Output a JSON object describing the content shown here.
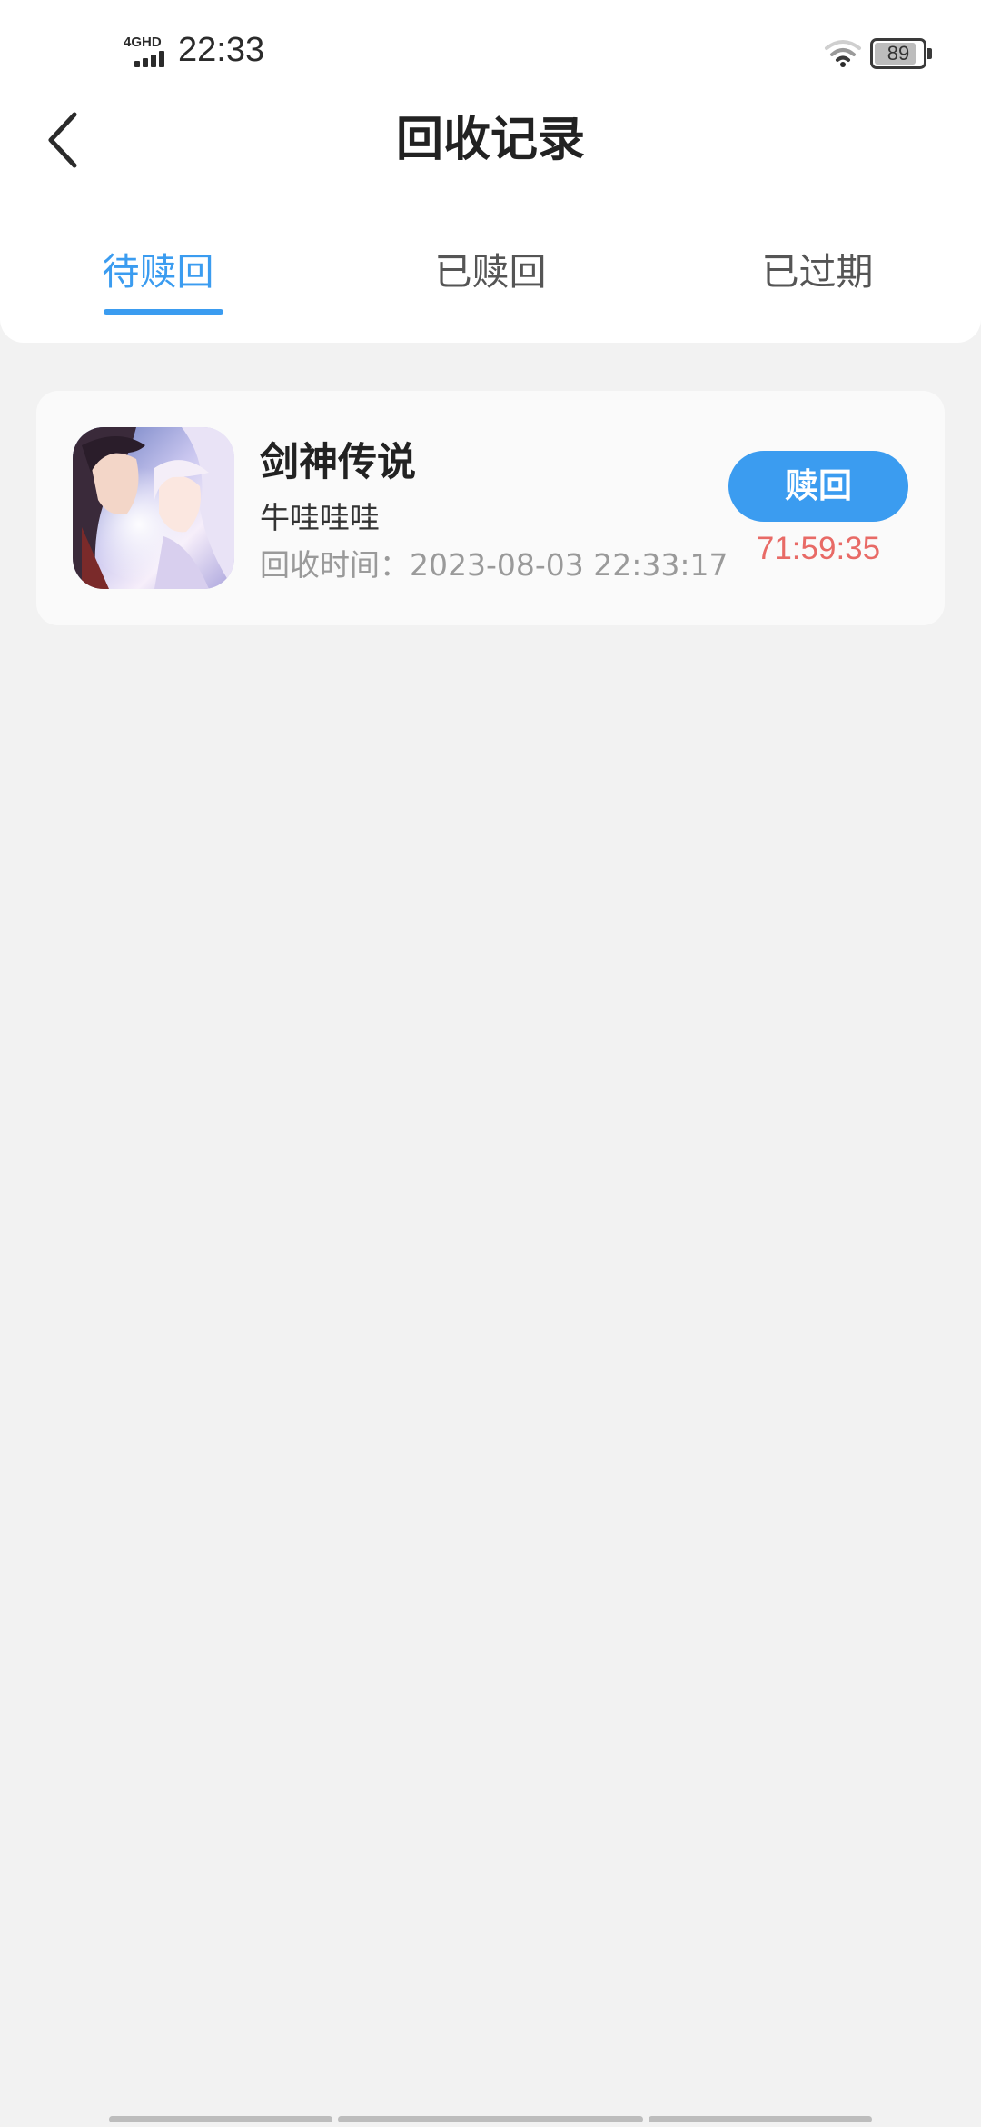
{
  "status_bar": {
    "network": "4GHD",
    "time": "22:33",
    "battery": "89",
    "battery_level": 0.89,
    "wifi_icon": "wifi-icon",
    "signal_icon": "signal-icon"
  },
  "header": {
    "title": "回收记录",
    "back_icon": "chevron-left-icon"
  },
  "tabs": [
    {
      "label": "待赎回",
      "active": true
    },
    {
      "label": "已赎回",
      "active": false
    },
    {
      "label": "已过期",
      "active": false
    }
  ],
  "records": [
    {
      "game_name": "剑神传说",
      "account": "牛哇哇哇",
      "recycle_time": "回收时间：2023-08-03 22:33:17",
      "action_label": "赎回",
      "countdown": "71:59:35"
    }
  ],
  "colors": {
    "accent": "#3b9cf0",
    "countdown": "#e86a66",
    "background": "#f2f2f2",
    "card": "#fafafa"
  }
}
